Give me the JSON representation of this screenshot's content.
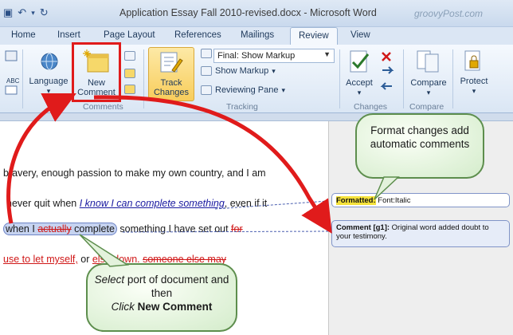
{
  "window": {
    "title": "Application Essay Fall 2010-revised.docx - Microsoft Word",
    "watermark": "groovyPost.com"
  },
  "tabs": [
    "Home",
    "Insert",
    "Page Layout",
    "References",
    "Mailings",
    "Review",
    "View"
  ],
  "active_tab": "Review",
  "ribbon": {
    "language_label": "Language",
    "new_comment_label_1": "New",
    "new_comment_label_2": "Comment",
    "comments_group": "Comments",
    "track_changes_label_1": "Track",
    "track_changes_label_2": "Changes",
    "markup_select_value": "Final: Show Markup",
    "show_markup": "Show Markup",
    "reviewing_pane": "Reviewing Pane",
    "tracking_group": "Tracking",
    "accept_label": "Accept",
    "changes_group": "Changes",
    "compare_label": "Compare",
    "compare_group": "Compare",
    "protect_label": "Protect"
  },
  "document": {
    "line1": "bravery, enough  passion to make my own country, and I am",
    "line2_a": "never quit when ",
    "line2_b": "I know I can complete something",
    "line2_c": ", even if it",
    "line3_a": "when I ",
    "line3_strike": "actually",
    "line3_b": " complete",
    "line3_c": " something I have set out ",
    "line3_strike2": "for",
    "line4_a": "use to let myself,",
    "line4_b": " or ",
    "line4_c": "else down.",
    "line4_d": "someone else may"
  },
  "balloons": {
    "formatted_label": "Formatted:",
    "formatted_text": " Font:Italic",
    "comment_label": "Comment [g1]:",
    "comment_text": " Original word added doubt to your testimony."
  },
  "callouts": {
    "top_text": "Format changes add automatic comments",
    "bottom_1": "Select",
    "bottom_2": " port of document and then",
    "bottom_3": "Click",
    "bottom_4": "New Comment"
  },
  "colors": {
    "annotation_red": "#e01b1b",
    "callout_green": "#5d8e4d",
    "balloon_border": "#8094c8"
  }
}
